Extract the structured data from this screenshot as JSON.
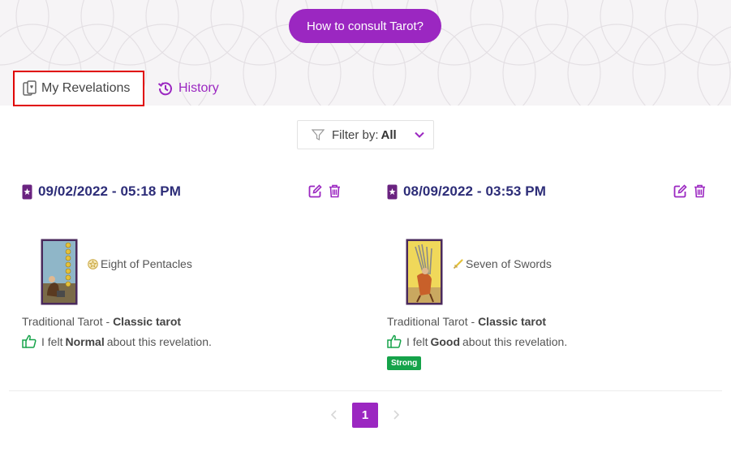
{
  "hero": {
    "consult_label": "How to consult Tarot?"
  },
  "tabs": [
    {
      "label": "My Revelations",
      "active": true
    },
    {
      "label": "History",
      "active": false
    }
  ],
  "filter": {
    "label": "Filter by:",
    "value": "All"
  },
  "revelations": [
    {
      "date": "09/02/2022 - 05:18 PM",
      "card_name": "Eight of Pentacles",
      "deck": "Traditional Tarot - ",
      "deck_type": "Classic tarot",
      "felt_prefix": "I felt",
      "feeling": "Normal",
      "felt_suffix": "about this revelation.",
      "badge": ""
    },
    {
      "date": "08/09/2022 - 03:53 PM",
      "card_name": "Seven of Swords",
      "deck": "Traditional Tarot - ",
      "deck_type": "Classic tarot",
      "felt_prefix": "I felt",
      "feeling": "Good",
      "felt_suffix": "about this revelation.",
      "badge": "Strong"
    }
  ],
  "pagination": {
    "current": "1"
  },
  "colors": {
    "accent": "#9b27c1",
    "date": "#2d2d78",
    "badge": "#15a34a",
    "highlight": "#e00000"
  }
}
